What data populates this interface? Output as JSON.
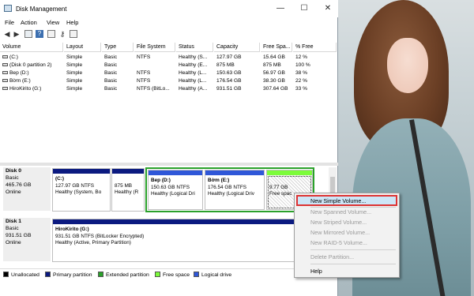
{
  "window": {
    "title": "Disk Management",
    "minimize": "—",
    "maximize": "☐",
    "close": "✕"
  },
  "menu": [
    "File",
    "Action",
    "View",
    "Help"
  ],
  "toolbar_icons": [
    "back-icon",
    "forward-icon",
    "properties-icon",
    "help-icon",
    "settings-icon",
    "view-icon"
  ],
  "table": {
    "headers": [
      "Volume",
      "Layout",
      "Type",
      "File System",
      "Status",
      "Capacity",
      "Free Spa...",
      "% Free"
    ],
    "rows": [
      [
        "(C:)",
        "Simple",
        "Basic",
        "NTFS",
        "Healthy (S...",
        "127.97 GB",
        "15.64 GB",
        "12 %"
      ],
      [
        "(Disk 0 partition 2)",
        "Simple",
        "Basic",
        "",
        "Healthy (E...",
        "875 MB",
        "875 MB",
        "100 %"
      ],
      [
        "Bep (D:)",
        "Simple",
        "Basic",
        "NTFS",
        "Healthy (L...",
        "150.63 GB",
        "56.97 GB",
        "38 %"
      ],
      [
        "Bờm (E:)",
        "Simple",
        "Basic",
        "NTFS",
        "Healthy (L...",
        "176.54 GB",
        "38.30 GB",
        "22 %"
      ],
      [
        "HiroKirito (G:)",
        "Simple",
        "Basic",
        "NTFS (BitLo...",
        "Healthy (A...",
        "931.51 GB",
        "307.64 GB",
        "33 %"
      ]
    ]
  },
  "disks": [
    {
      "name": "Disk 0",
      "type": "Basic",
      "size": "465.76 GB",
      "status": "Online",
      "partitions": [
        {
          "title": "(C:)",
          "line2": "127.97 GB NTFS",
          "line3": "Healthy (System, Bo"
        },
        {
          "title": "",
          "line2": "875 MB",
          "line3": "Healthy (R"
        },
        {
          "title": "Bep  (D:)",
          "line2": "150.63 GB NTFS",
          "line3": "Healthy (Logical Dri"
        },
        {
          "title": "Bờm  (E:)",
          "line2": "176.54 GB NTFS",
          "line3": "Healthy (Logical Driv"
        },
        {
          "title": "",
          "line2": "9.77 GB",
          "line3": "Free spac"
        }
      ]
    },
    {
      "name": "Disk 1",
      "type": "Basic",
      "size": "931.51 GB",
      "status": "Online",
      "partitions": [
        {
          "title": "HiroKirito  (G:)",
          "line2": "931.51 GB NTFS (BitLocker Encrypted)",
          "line3": "Healthy (Active, Primary Partition)"
        }
      ]
    }
  ],
  "legend": [
    {
      "label": "Unallocated",
      "color": "#000000"
    },
    {
      "label": "Primary partition",
      "color": "#0b1a80"
    },
    {
      "label": "Extended partition",
      "color": "#2aa12a"
    },
    {
      "label": "Free space",
      "color": "#7cfc3a"
    },
    {
      "label": "Logical drive",
      "color": "#2f57d8"
    }
  ],
  "context_menu": [
    {
      "label": "New Simple Volume...",
      "enabled": true,
      "highlighted": true
    },
    {
      "label": "New Spanned Volume...",
      "enabled": false
    },
    {
      "label": "New Striped Volume...",
      "enabled": false
    },
    {
      "label": "New Mirrored Volume...",
      "enabled": false
    },
    {
      "label": "New RAID-5 Volume...",
      "enabled": false
    },
    {
      "label": "Delete Partition...",
      "enabled": false
    },
    {
      "label": "Help",
      "enabled": true
    }
  ]
}
